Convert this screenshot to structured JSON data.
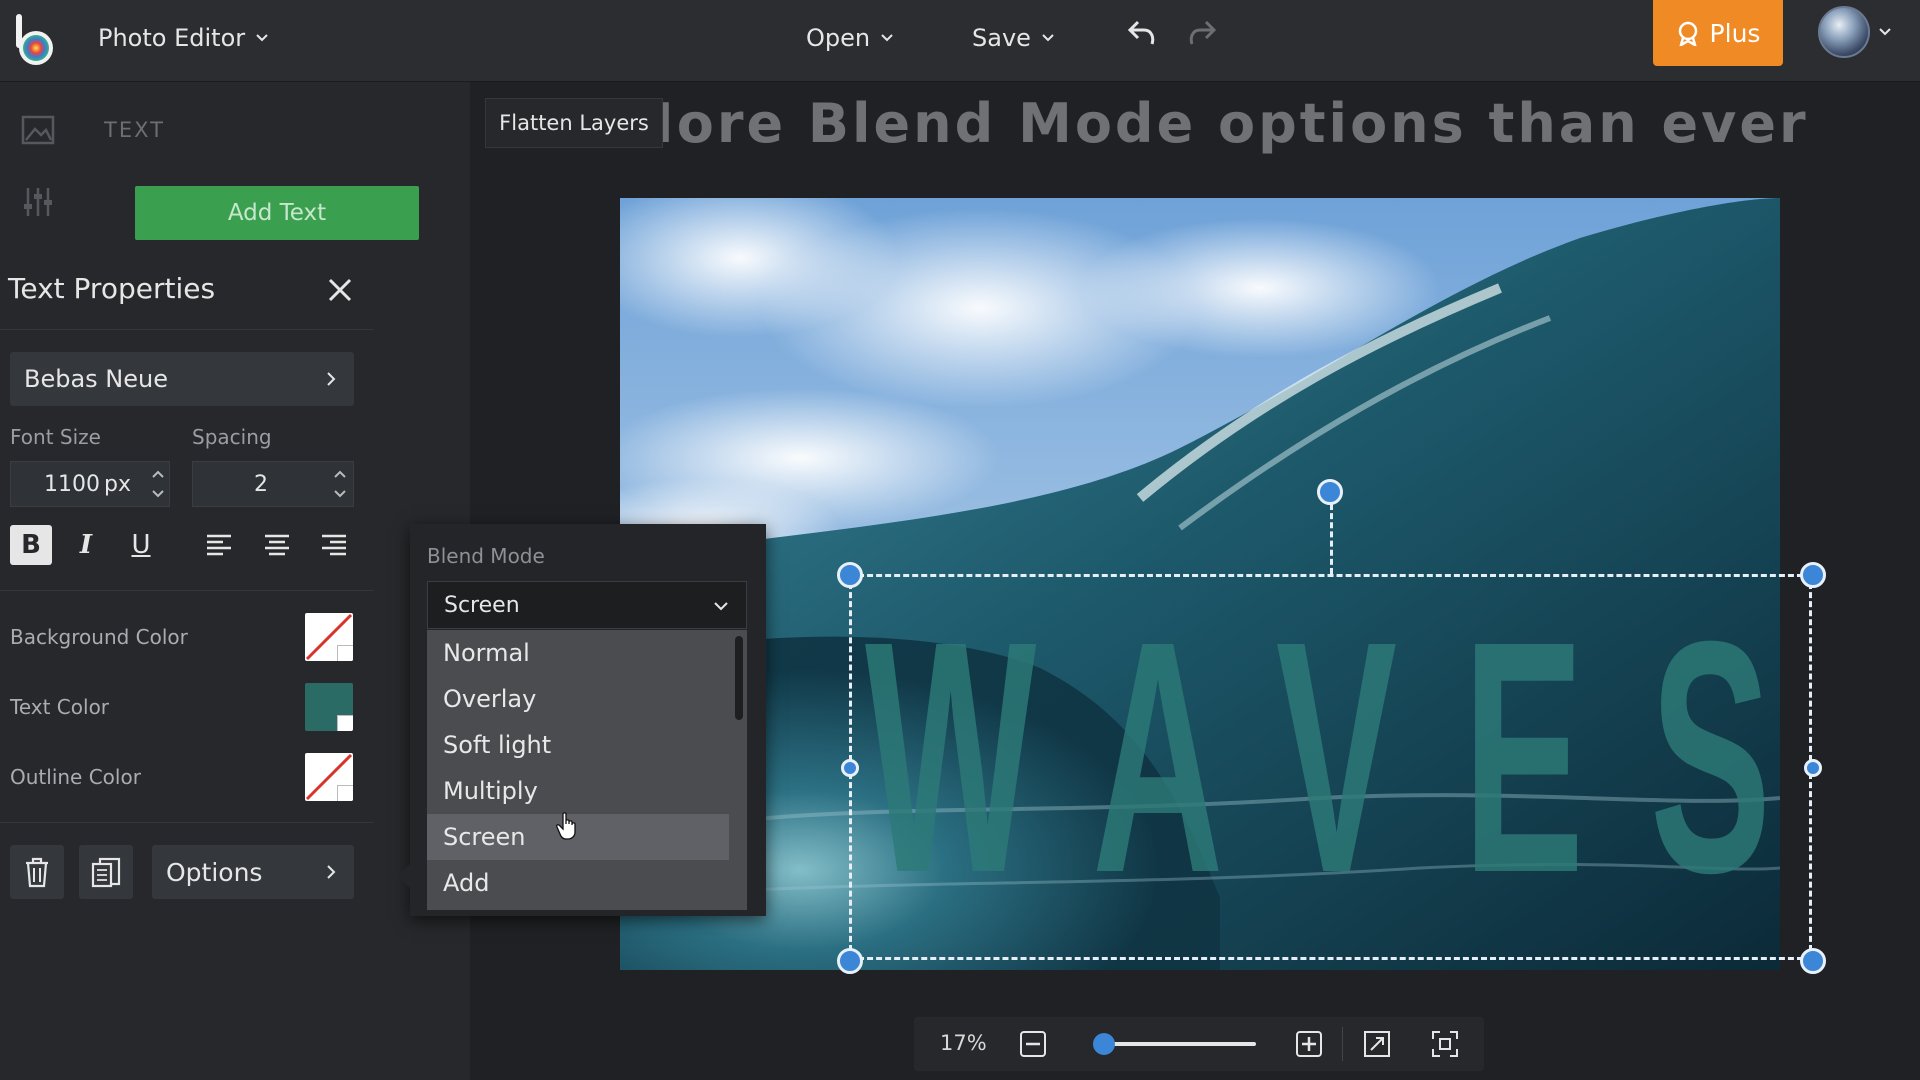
{
  "app": {
    "menu_label": "Photo Editor"
  },
  "topbar": {
    "open_label": "Open",
    "save_label": "Save",
    "plus_label": "Plus"
  },
  "side_panel": {
    "title": "TEXT",
    "add_text_label": "Add Text"
  },
  "text_properties": {
    "title": "Text Properties",
    "font_name": "Bebas Neue",
    "font_size_label": "Font Size",
    "font_size_value": "1100",
    "font_size_unit": "px",
    "spacing_label": "Spacing",
    "spacing_value": "2",
    "format_buttons": {
      "bold": "B",
      "italic": "I",
      "underline": "U"
    },
    "background_color_label": "Background Color",
    "text_color_label": "Text Color",
    "text_color": "#2a6b66",
    "outline_color_label": "Outline Color",
    "options_label": "Options"
  },
  "blend_mode": {
    "label": "Blend Mode",
    "selected": "Screen",
    "options": [
      "Normal",
      "Overlay",
      "Soft light",
      "Multiply",
      "Screen",
      "Add"
    ],
    "hovered": "Screen"
  },
  "canvas": {
    "flatten_label": "Flatten Layers",
    "headline": "More Blend Mode options than ever",
    "layer_text": "WAVES"
  },
  "zoom": {
    "percent": "17%",
    "slider_fraction": 0.05
  },
  "colors": {
    "accent_orange": "#f08a24",
    "accent_green": "#3aa050",
    "handle_blue": "#3c86d8"
  }
}
